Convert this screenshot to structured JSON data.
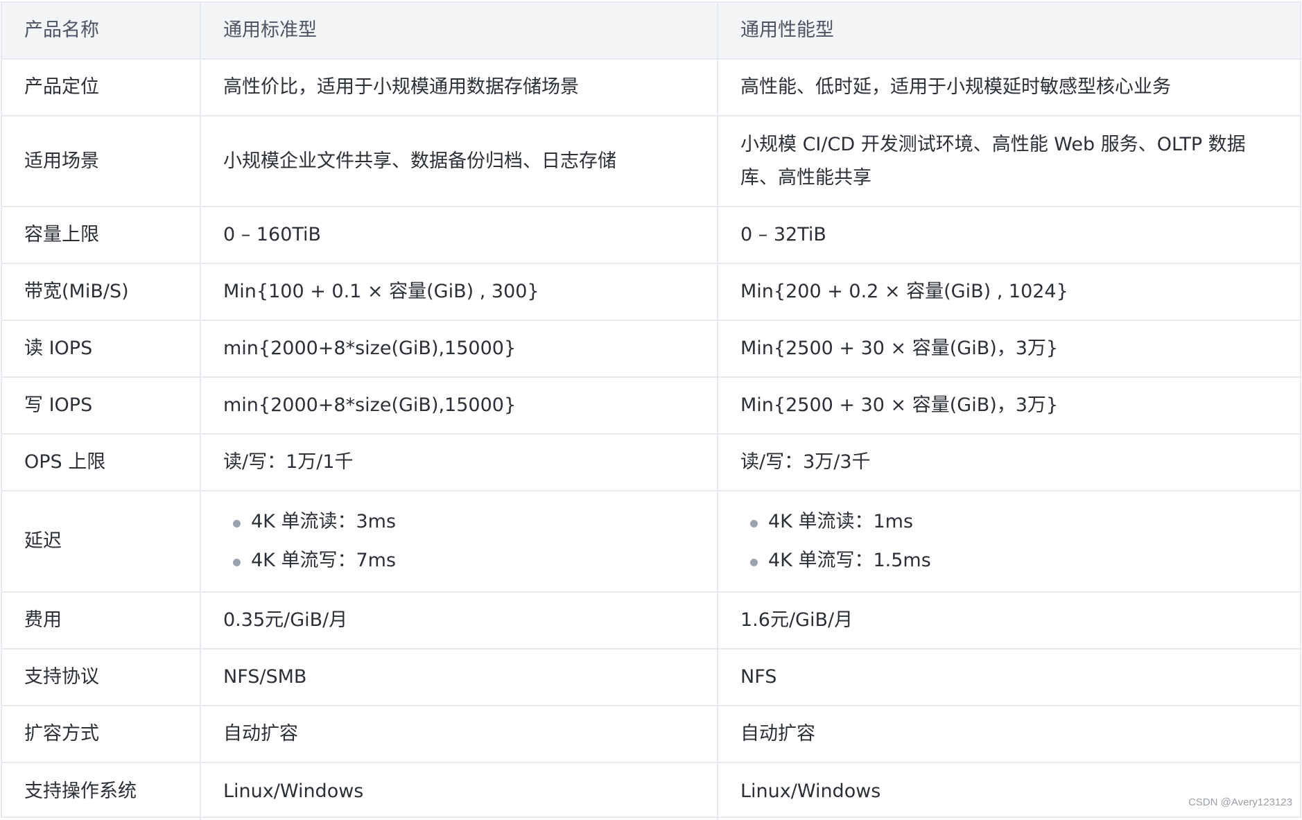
{
  "table": {
    "headers": [
      "产品名称",
      "通用标准型",
      "通用性能型"
    ],
    "rows": [
      {
        "label": "产品定位",
        "standard": "高性价比，适用于小规模通用数据存储场景",
        "performance": "高性能、低时延，适用于小规模延时敏感型核心业务"
      },
      {
        "label": "适用场景",
        "standard": "小规模企业文件共享、数据备份归档、日志存储",
        "performance": "小规模 CI/CD 开发测试环境、高性能 Web 服务、OLTP 数据库、高性能共享"
      },
      {
        "label": "容量上限",
        "standard": "0 – 160TiB",
        "performance": "0 – 32TiB"
      },
      {
        "label": "带宽(MiB/S)",
        "standard": "Min{100 + 0.1 × 容量(GiB) , 300}",
        "performance": "Min{200 + 0.2 × 容量(GiB) , 1024}"
      },
      {
        "label": "读 IOPS",
        "standard": "min{2000+8*size(GiB),15000}",
        "performance": "Min{2500 + 30 × 容量(GiB)，3万}"
      },
      {
        "label": "写 IOPS",
        "standard": "min{2000+8*size(GiB),15000}",
        "performance": "Min{2500 + 30 × 容量(GiB)，3万}"
      },
      {
        "label": "OPS 上限",
        "standard": "读/写：1万/1千",
        "performance": "读/写：3万/3千"
      },
      {
        "label": "延迟",
        "standard_list": [
          "4K 单流读：3ms",
          "4K 单流写：7ms"
        ],
        "performance_list": [
          "4K 单流读：1ms",
          "4K 单流写：1.5ms"
        ]
      },
      {
        "label": "费用",
        "standard": "0.35元/GiB/月",
        "performance": "1.6元/GiB/月"
      },
      {
        "label": "支持协议",
        "standard": "NFS/SMB",
        "performance": "NFS"
      },
      {
        "label": "扩容方式",
        "standard": "自动扩容",
        "performance": "自动扩容"
      },
      {
        "label": "支持操作系统",
        "standard": "Linux/Windows",
        "performance": "Linux/Windows"
      }
    ]
  },
  "watermark": "CSDN @Avery123123"
}
